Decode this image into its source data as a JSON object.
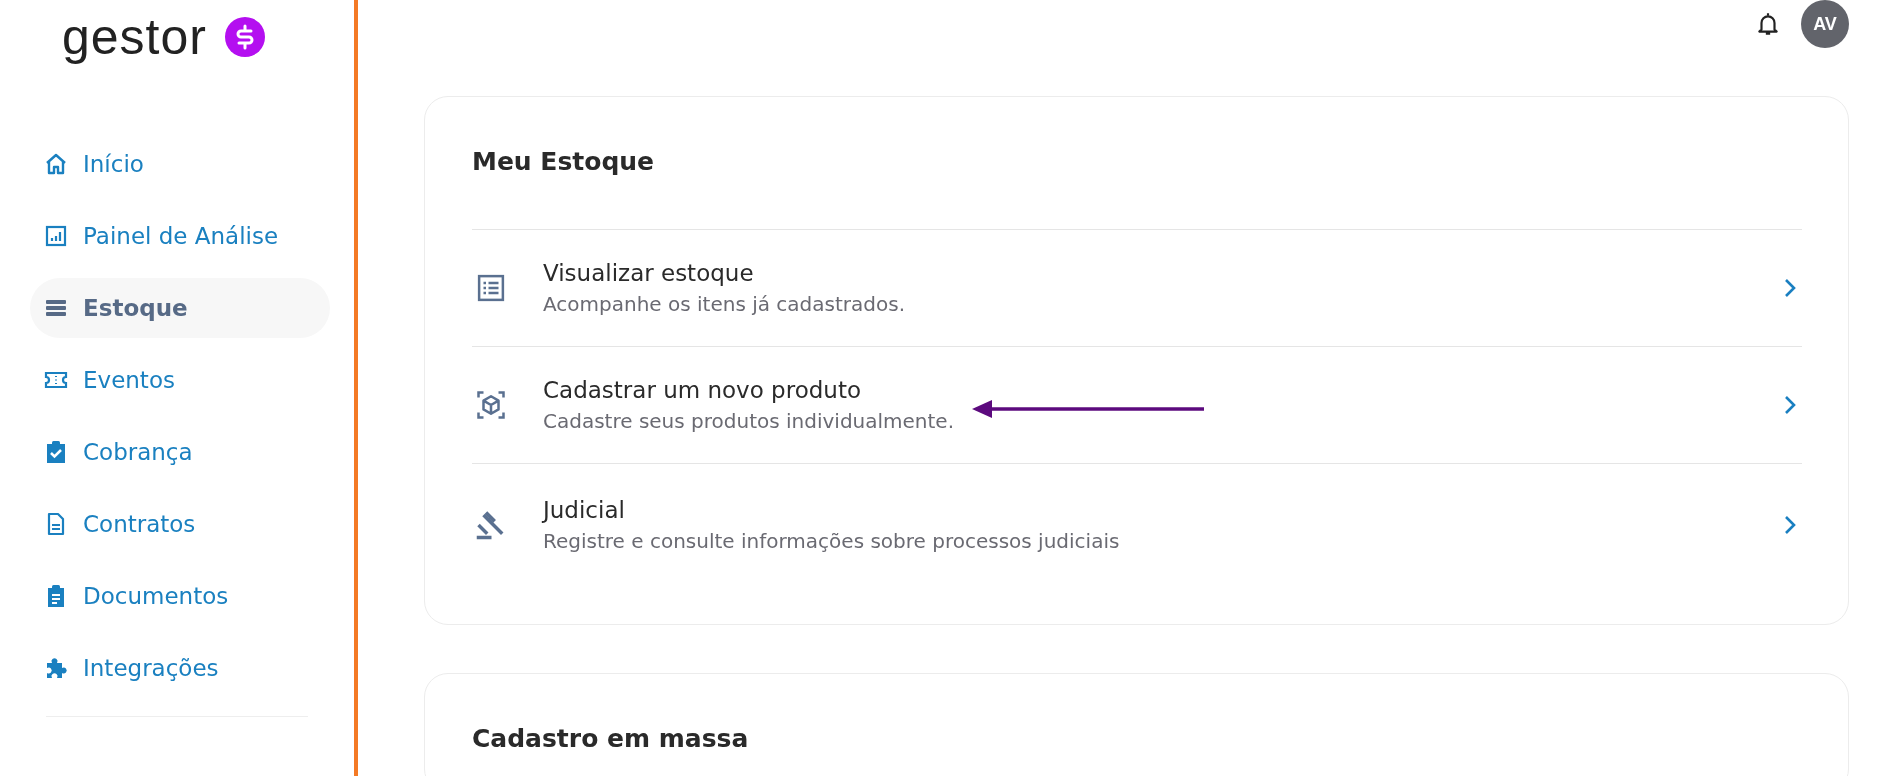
{
  "logo": {
    "text": "gestor"
  },
  "sidebar": {
    "items": [
      {
        "label": "Início",
        "selected": false
      },
      {
        "label": "Painel de Análise",
        "selected": false
      },
      {
        "label": "Estoque",
        "selected": true
      },
      {
        "label": "Eventos",
        "selected": false
      },
      {
        "label": "Cobrança",
        "selected": false
      },
      {
        "label": "Contratos",
        "selected": false
      },
      {
        "label": "Documentos",
        "selected": false
      },
      {
        "label": "Integrações",
        "selected": false
      }
    ]
  },
  "header": {
    "avatar": "AV"
  },
  "cards": [
    {
      "title": "Meu Estoque",
      "rows": [
        {
          "title": "Visualizar estoque",
          "subtitle": "Acompanhe os itens já cadastrados.",
          "annotated": false
        },
        {
          "title": "Cadastrar um novo produto",
          "subtitle": "Cadastre seus produtos individualmente.",
          "annotated": true
        },
        {
          "title": "Judicial",
          "subtitle": "Registre e consulte informações sobre processos judiciais",
          "annotated": false
        }
      ]
    },
    {
      "title": "Cadastro em massa"
    }
  ]
}
